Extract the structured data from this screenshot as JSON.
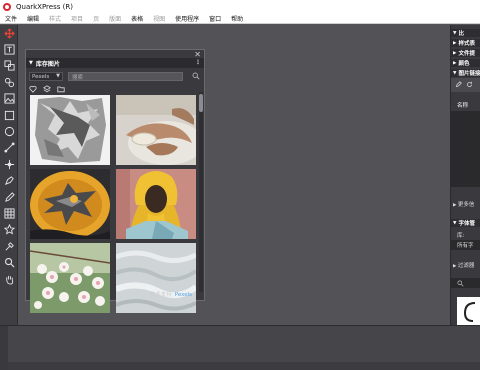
{
  "app": {
    "title": "QuarkXPress (R)"
  },
  "menu": [
    {
      "label": "文件",
      "enabled": true
    },
    {
      "label": "编辑",
      "enabled": true
    },
    {
      "label": "样式",
      "enabled": false
    },
    {
      "label": "项目",
      "enabled": false
    },
    {
      "label": "页",
      "enabled": false
    },
    {
      "label": "版面",
      "enabled": false
    },
    {
      "label": "表格",
      "enabled": true
    },
    {
      "label": "视图",
      "enabled": false
    },
    {
      "label": "使用程序",
      "enabled": true
    },
    {
      "label": "窗口",
      "enabled": true
    },
    {
      "label": "帮助",
      "enabled": true
    }
  ],
  "tools": [
    "move-tool-icon",
    "text-tool-icon",
    "text-link-icon",
    "unlink-icon",
    "picture-tool-icon",
    "rectangle-tool-icon",
    "oval-tool-icon",
    "line-tool-icon",
    "bezier-pen-icon",
    "pen-add-point-icon",
    "pencil-icon",
    "table-tool-icon",
    "star-tool-icon",
    "eyedropper-icon",
    "zoom-icon",
    "pan-hand-icon"
  ],
  "image_panel": {
    "title": "库存图片",
    "menu_glyph": "⋮",
    "close_glyph": "✕",
    "source": "Pexels",
    "search_placeholder": "搜索",
    "credit_text": "技术支持",
    "credit_link": "Pexels",
    "images": [
      {
        "subject": "crumpled aluminum foil"
      },
      {
        "subject": "hands holding seashell"
      },
      {
        "subject": "abstract bird in yellow bowl"
      },
      {
        "subject": "woman in yellow headscarf"
      },
      {
        "subject": "white and pink blossoms"
      },
      {
        "subject": "pale ripple texture"
      }
    ]
  },
  "right_panels": [
    {
      "label": "比",
      "expanded": true
    },
    {
      "label": "样式表",
      "expanded": false
    },
    {
      "label": "文件提",
      "expanded": false
    },
    {
      "label": "颜色",
      "expanded": false
    },
    {
      "label": "图片链接",
      "expanded": true
    }
  ],
  "right_panel_texts": {
    "name_header": "名称",
    "more_info": "更多信",
    "font_manager": "字体管",
    "library_label": "库:",
    "all_fonts": "所有字",
    "filter": "过滤器"
  },
  "colors": {
    "accent": "#e8423b",
    "link": "#5aa0e6",
    "panel_bg": "#3a3a3e",
    "workspace_bg": "#525257"
  }
}
